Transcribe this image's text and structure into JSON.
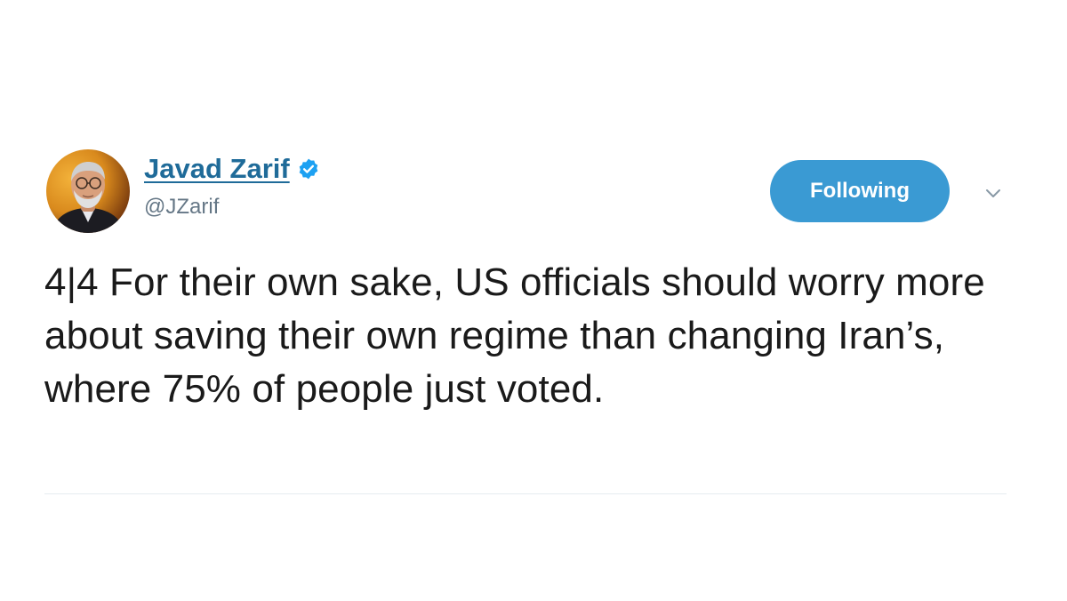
{
  "tweet": {
    "author": {
      "display_name": "Javad Zarif",
      "handle": "@JZarif",
      "verified": true,
      "avatar_icon": "profile-photo"
    },
    "follow_button_label": "Following",
    "menu_icon": "chevron-down-icon",
    "text": "4|4 For their own sake, US officials should worry more about saving their own regime than changing Iran’s, where 75% of people just voted."
  },
  "colors": {
    "accent": "#3a9ad3",
    "name_link": "#1f6b99",
    "handle_gray": "#657786",
    "text": "#1a1a1a",
    "divider": "#e6ecf0"
  }
}
